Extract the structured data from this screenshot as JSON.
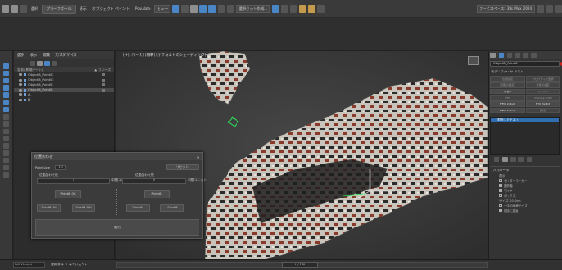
{
  "menubar": {
    "item1": "選択",
    "item2": "プリーフポール",
    "item3": "表示",
    "item4": "オブジェクト ペイント",
    "item5": "Populate",
    "view_dropdown": "ビュー",
    "selection_set": "選択セット作成...",
    "workspace": "ワークスペース: 3ds Max 2024"
  },
  "explorer": {
    "tabs": [
      "選択",
      "表示",
      "編集",
      "カスタマイズ"
    ],
    "col_name": "名前 (昇順ソート)",
    "col_freeze": "▲ フリーズ",
    "rows": [
      {
        "label": "Object8_Point02",
        "selected": false
      },
      {
        "label": "Object8_Point03",
        "selected": false
      },
      {
        "label": "Object8_Point01",
        "selected": false
      },
      {
        "label": "Object8_Point01",
        "selected": true
      },
      {
        "label": "A",
        "selected": false
      },
      {
        "label": "B",
        "selected": false
      }
    ]
  },
  "viewport": {
    "label": "[+] [パース] [標準] [デフォルトのシェーディング]"
  },
  "right_panel": {
    "object_name": "Object8_Point01",
    "modifier_list": "モディファイヤ リスト",
    "buttons": [
      {
        "label": "位置設定",
        "on": false
      },
      {
        "label": "プロパティを選択",
        "on": false
      },
      {
        "label": "回転の設定",
        "on": false
      },
      {
        "label": "位置の設定",
        "on": false
      },
      {
        "label": "スピー",
        "on": true
      },
      {
        "label": "フィルタ",
        "on": false
      },
      {
        "label": "FFD",
        "on": false
      },
      {
        "label": "Unwrap UVW",
        "on": false
      },
      {
        "label": "FFD 2x2x2",
        "on": true
      },
      {
        "label": "FFD 3x3x3",
        "on": true
      },
      {
        "label": "FFD 4x4x4",
        "on": true
      },
      {
        "label": "頂点",
        "on": false
      }
    ],
    "stack_item": "選択したテスト",
    "params_title": "パラメータ",
    "params": [
      {
        "label": "表示",
        "check": false
      },
      {
        "label": "センターマーカー",
        "check": false
      },
      {
        "label": "座標軸",
        "check": true
      },
      {
        "label": "ワイヤ",
        "check": true
      },
      {
        "label": "ボックス",
        "check": false
      },
      {
        "label": "サイズ: 20.0cm",
        "check": false
      },
      {
        "label": "一定の画面サイズ",
        "check": false
      },
      {
        "label": "前面に描画",
        "check": true
      }
    ]
  },
  "status": {
    "input_text": "MAXScript",
    "selection": "選択済み: 1 オブジェクト",
    "frame": "0 / 100"
  },
  "dialog": {
    "title": "位置合わせ",
    "point_label": "PointSize",
    "point_value": "1.0",
    "reset_button": "リセット",
    "left_heading": "位置合わせ元",
    "left_value": "0",
    "left_unit": "中間ユニット",
    "right_heading": "位置合わせ先",
    "right_value": "0",
    "right_unit": "中間ユニット",
    "left_button_top": "Point8 OK",
    "left_button_a": "Point8 OK",
    "left_button_b": "Point8 OK",
    "right_button_top": "Point8",
    "right_button_a": "Point8",
    "right_button_b": "Point8",
    "run_button": "実行"
  },
  "colors": {
    "accent": "#2f6fb0",
    "swatch": "#e12020"
  }
}
